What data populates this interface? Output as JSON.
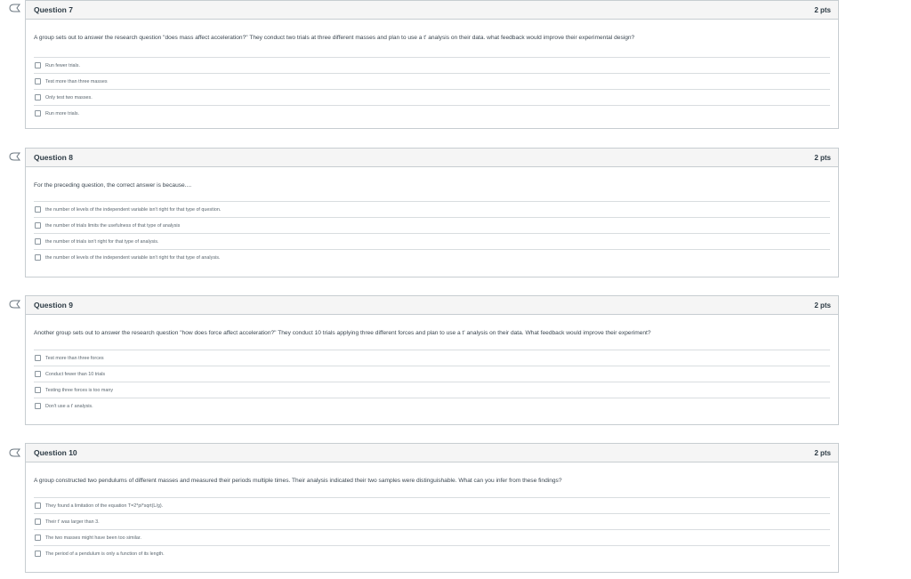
{
  "questions": [
    {
      "title": "Question 7",
      "points": "2 pts",
      "text": "A group sets out to answer the research question \"does mass affect acceleration?\" They conduct two trials at three different masses and plan to use a t' analysis on their data. what feedback would improve their experimental design?",
      "answers": [
        "Run fewer trials.",
        "Test more than three masses",
        "Only test two masses.",
        "Run more trials."
      ]
    },
    {
      "title": "Question 8",
      "points": "2 pts",
      "text": "For the preceding question, the correct answer is because....",
      "answers": [
        "the number of levels of the independent variable isn't right for that type of question.",
        "the number of trials limits the usefulness of that type of analysis",
        "the number of trials isn't right for that type of analysis.",
        "the number of levels of the independent variable isn't right for that type of analysis."
      ]
    },
    {
      "title": "Question 9",
      "points": "2 pts",
      "text": "Another group sets out to answer the research question \"how does force affect acceleration?\" They conduct 10 trials applying three different forces and plan to use a t' analysis on their data. What feedback would improve their experiment?",
      "answers": [
        "Test more than three forces",
        "Conduct fewer than 10 trials",
        "Testing three forces is too many",
        "Don't use a t' analysis."
      ]
    },
    {
      "title": "Question 10",
      "points": "2 pts",
      "text": "A group constructed two pendulums of different masses and measured their periods multiple times. Their analysis indicated their two samples were distinguishable. What can you infer from these findings?",
      "answers": [
        "They found a limitation of the equation T=2*pi*sqrt(L/g).",
        "Their t' was larger than 3.",
        "The two masses might have been too similar.",
        "The period of a pendulum is only a function of its length."
      ]
    }
  ]
}
